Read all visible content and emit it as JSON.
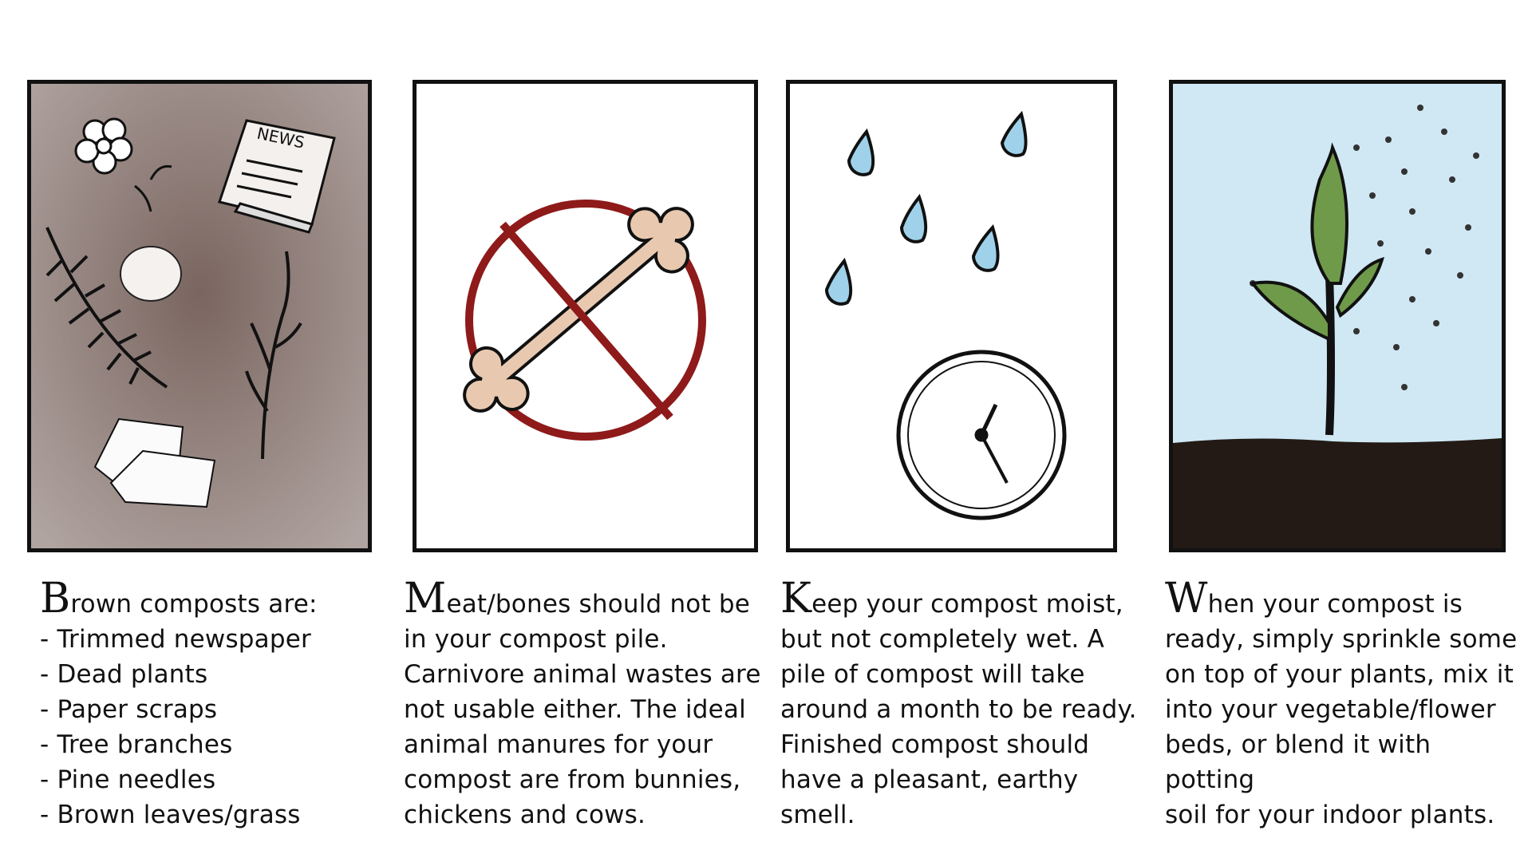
{
  "panels": [
    {
      "name": "brown-composts",
      "newspaper_label": "NEWS",
      "initial": "B",
      "caption": "rown composts are:\n- Trimmed newspaper\n- Dead plants\n- Paper scraps\n- Tree branches\n- Pine needles\n- Brown leaves/grass"
    },
    {
      "name": "no-meat-bones",
      "initial": "M",
      "caption": "eat/bones should not be\nin your compost pile.\nCarnivore animal wastes are\nnot usable either. The ideal\nanimal manures for your\ncompost are from bunnies,\nchickens and cows."
    },
    {
      "name": "keep-moist",
      "initial": "K",
      "caption": "eep your compost moist,\nbut not completely wet. A\npile of compost will take\naround a month to be ready.\nFinished compost should\nhave a pleasant, earthy smell."
    },
    {
      "name": "use-compost",
      "initial": "W",
      "caption": "hen your compost is\nready, simply sprinkle some\non top of your plants, mix it\ninto your vegetable/flower\nbeds, or blend it with potting\nsoil for your indoor plants."
    }
  ],
  "colors": {
    "brown_bg": "#8a7a74",
    "prohibition_red": "#8e1a1a",
    "bone": "#e8c9b0",
    "raindrop": "#9fd2ea",
    "sky": "#cfe8f3",
    "leaf": "#6f9a4a",
    "soil": "#231a16"
  }
}
